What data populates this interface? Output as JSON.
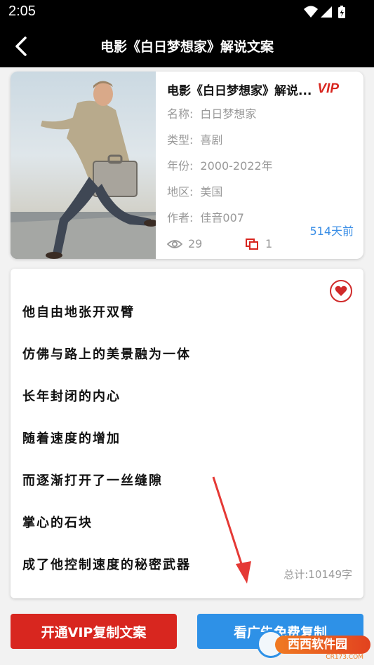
{
  "status_bar": {
    "time": "2:05"
  },
  "header": {
    "title": "电影《白日梦想家》解说文案"
  },
  "card": {
    "title": "电影《白日梦想家》解说...",
    "vip_badge": "VIP",
    "fields": [
      {
        "label": "名称:",
        "value": "白日梦想家"
      },
      {
        "label": "类型:",
        "value": "喜剧"
      },
      {
        "label": "年份:",
        "value": "2000-2022年"
      },
      {
        "label": "地区:",
        "value": "美国"
      },
      {
        "label": "作者:",
        "value": "佳音007"
      }
    ],
    "time_ago": "514天前",
    "views": "29",
    "copies": "1"
  },
  "text": {
    "lines": [
      "他自由地张开双臂",
      "仿佛与路上的美景融为一体",
      "长年封闭的内心",
      "随着速度的增加",
      "而逐渐打开了一丝缝隙",
      "掌心的石块",
      "成了他控制速度的秘密武器"
    ],
    "total": "总计:10149字"
  },
  "buttons": {
    "vip_copy": "开通VIP复制文案",
    "ad_copy": "看广告免费复制"
  },
  "watermark": {
    "label": "西西软件园",
    "domain": "CR173.COM"
  },
  "colors": {
    "accent_red": "#d8261f",
    "accent_blue": "#2e91e7",
    "link_blue": "#3a8ee6"
  }
}
